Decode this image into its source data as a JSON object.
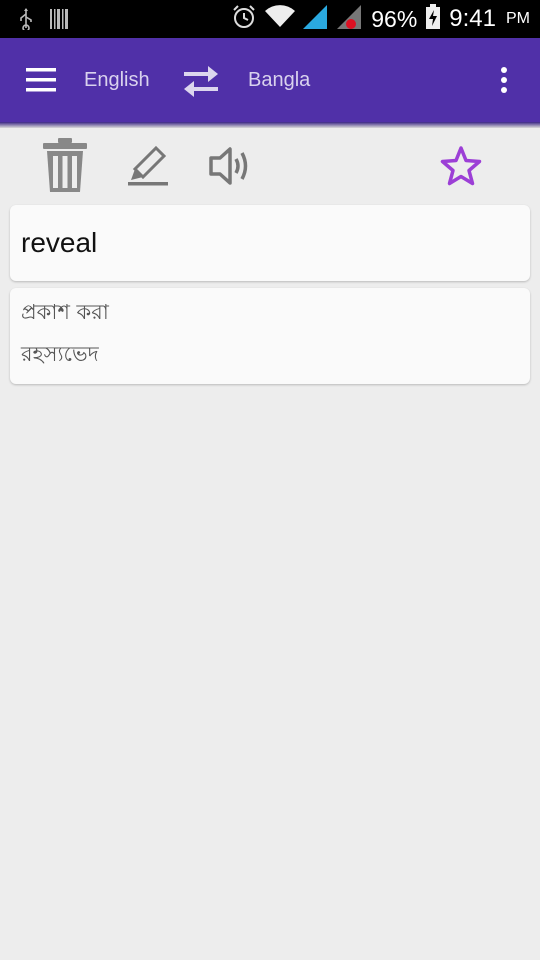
{
  "status_bar": {
    "battery": "96%",
    "time": "9:41",
    "ampm": "PM",
    "icons": [
      "usb-icon",
      "barcode-icon",
      "alarm-icon",
      "wifi-icon",
      "signal-icon",
      "signal-roaming-icon",
      "battery-charging-icon"
    ]
  },
  "app_bar": {
    "source_language": "English",
    "target_language": "Bangla",
    "icons": [
      "menu-icon",
      "swap-icon",
      "more-vert-icon"
    ],
    "color": "#5030a8"
  },
  "toolbar": {
    "icons": [
      "trash-icon",
      "edit-icon",
      "speaker-icon",
      "star-icon"
    ],
    "star_color": "#9c3fd6"
  },
  "word": {
    "text": "reveal"
  },
  "meanings": [
    "প্রকাশ করা",
    "রহস্যভেদ"
  ]
}
